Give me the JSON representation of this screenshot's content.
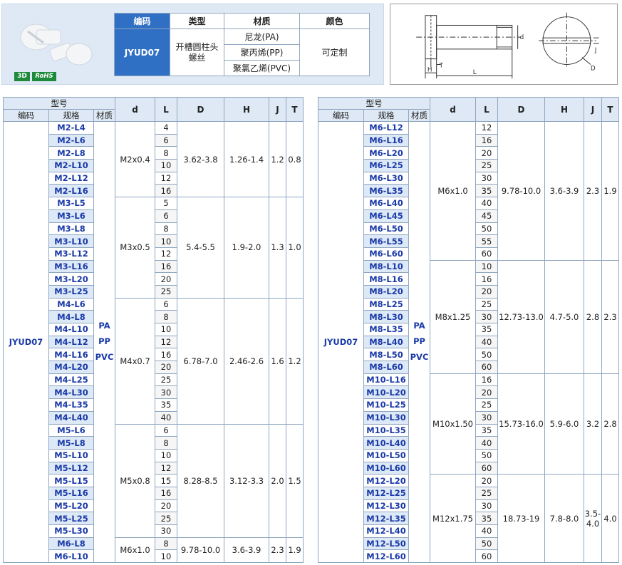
{
  "badges": {
    "three_d": "3D",
    "rohs": "RoHS"
  },
  "info_table": {
    "headers": {
      "code": "编码",
      "type": "类型",
      "material": "材质",
      "color": "颜色"
    },
    "code": "JYUD07",
    "type": "开槽圆柱头\n螺丝",
    "materials": [
      "尼龙(PA)",
      "聚丙烯(PP)",
      "聚氯乙烯(PVC)"
    ],
    "color": "可定制"
  },
  "diagram": {
    "labels": {
      "d": "d",
      "T": "T",
      "H": "H",
      "L": "L",
      "J": "J",
      "D": "D"
    },
    "icon": "slotted-screw-drawing"
  },
  "spec_headers": {
    "model": "型号",
    "code": "编码",
    "spec": "规格",
    "material": "材质",
    "d": "d",
    "L": "L",
    "D": "D",
    "H": "H",
    "J": "J",
    "T": "T"
  },
  "left": {
    "code": "JYUD07",
    "materials": [
      "PA",
      "PP",
      "PVC"
    ],
    "groups": [
      {
        "d": "M2x0.4",
        "D": "3.62-3.8",
        "H": "1.26-1.4",
        "J": "1.2",
        "T": "0.8",
        "rows": [
          [
            "M2-L4",
            "4"
          ],
          [
            "M2-L6",
            "6"
          ],
          [
            "M2-L8",
            "8"
          ],
          [
            "M2-L10",
            "10"
          ],
          [
            "M2-L12",
            "12"
          ],
          [
            "M2-L16",
            "16"
          ]
        ]
      },
      {
        "d": "M3x0.5",
        "D": "5.4-5.5",
        "H": "1.9-2.0",
        "J": "1.3",
        "T": "1.0",
        "rows": [
          [
            "M3-L5",
            "5"
          ],
          [
            "M3-L6",
            "6"
          ],
          [
            "M3-L8",
            "8"
          ],
          [
            "M3-L10",
            "10"
          ],
          [
            "M3-L12",
            "12"
          ],
          [
            "M3-L16",
            "16"
          ],
          [
            "M3-L20",
            "20"
          ],
          [
            "M3-L25",
            "25"
          ]
        ]
      },
      {
        "d": "M4x0.7",
        "D": "6.78-7.0",
        "H": "2.46-2.6",
        "J": "1.6",
        "T": "1.2",
        "rows": [
          [
            "M4-L6",
            "6"
          ],
          [
            "M4-L8",
            "8"
          ],
          [
            "M4-L10",
            "10"
          ],
          [
            "M4-L12",
            "12"
          ],
          [
            "M4-L16",
            "16"
          ],
          [
            "M4-L20",
            "20"
          ],
          [
            "M4-L25",
            "25"
          ],
          [
            "M4-L30",
            "30"
          ],
          [
            "M4-L35",
            "35"
          ],
          [
            "M4-L40",
            "40"
          ]
        ]
      },
      {
        "d": "M5x0.8",
        "D": "8.28-8.5",
        "H": "3.12-3.3",
        "J": "2.0",
        "T": "1.5",
        "rows": [
          [
            "M5-L6",
            "6"
          ],
          [
            "M5-L8",
            "8"
          ],
          [
            "M5-L10",
            "10"
          ],
          [
            "M5-L12",
            "12"
          ],
          [
            "M5-L15",
            "15"
          ],
          [
            "M5-L16",
            "16"
          ],
          [
            "M5-L20",
            "20"
          ],
          [
            "M5-L25",
            "25"
          ],
          [
            "M5-L30",
            "30"
          ]
        ]
      },
      {
        "d": "M6x1.0",
        "D": "9.78-10.0",
        "H": "3.6-3.9",
        "J": "2.3",
        "T": "1.9",
        "rows": [
          [
            "M6-L8",
            "8"
          ],
          [
            "M6-L10",
            "10"
          ]
        ]
      }
    ]
  },
  "right": {
    "code": "JYUD07",
    "materials": [
      "PA",
      "PP",
      "PVC"
    ],
    "groups": [
      {
        "d": "M6x1.0",
        "D": "9.78-10.0",
        "H": "3.6-3.9",
        "J": "2.3",
        "T": "1.9",
        "rows": [
          [
            "M6-L12",
            "12"
          ],
          [
            "M6-L16",
            "16"
          ],
          [
            "M6-L20",
            "20"
          ],
          [
            "M6-L25",
            "25"
          ],
          [
            "M6-L30",
            "30"
          ],
          [
            "M6-L35",
            "35"
          ],
          [
            "M6-L40",
            "40"
          ],
          [
            "M6-L45",
            "45"
          ],
          [
            "M6-L50",
            "50"
          ],
          [
            "M6-L55",
            "55"
          ],
          [
            "M6-L60",
            "60"
          ]
        ]
      },
      {
        "d": "M8x1.25",
        "D": "12.73-13.0",
        "H": "4.7-5.0",
        "J": "2.8",
        "T": "2.3",
        "rows": [
          [
            "M8-L10",
            "10"
          ],
          [
            "M8-L16",
            "16"
          ],
          [
            "M8-L20",
            "20"
          ],
          [
            "M8-L25",
            "25"
          ],
          [
            "M8-L30",
            "30"
          ],
          [
            "M8-L35",
            "35"
          ],
          [
            "M8-L40",
            "40"
          ],
          [
            "M8-L50",
            "50"
          ],
          [
            "M8-L60",
            "60"
          ]
        ]
      },
      {
        "d": "M10x1.50",
        "D": "15.73-16.0",
        "H": "5.9-6.0",
        "J": "3.2",
        "T": "2.8",
        "rows": [
          [
            "M10-L16",
            "16"
          ],
          [
            "M10-L20",
            "20"
          ],
          [
            "M10-L25",
            "25"
          ],
          [
            "M10-L30",
            "30"
          ],
          [
            "M10-L35",
            "35"
          ],
          [
            "M10-L40",
            "40"
          ],
          [
            "M10-L50",
            "50"
          ],
          [
            "M10-L60",
            "60"
          ]
        ]
      },
      {
        "d": "M12x1.75",
        "D": "18.73-19",
        "H": "7.8-8.0",
        "J": "3.5-\n4.0",
        "T": "4.0",
        "rows": [
          [
            "M12-L20",
            "20"
          ],
          [
            "M12-L25",
            "25"
          ],
          [
            "M12-L30",
            "30"
          ],
          [
            "M12-L35",
            "35"
          ],
          [
            "M12-L40",
            "40"
          ],
          [
            "M12-L50",
            "50"
          ],
          [
            "M12-L60",
            "60"
          ]
        ]
      }
    ]
  }
}
